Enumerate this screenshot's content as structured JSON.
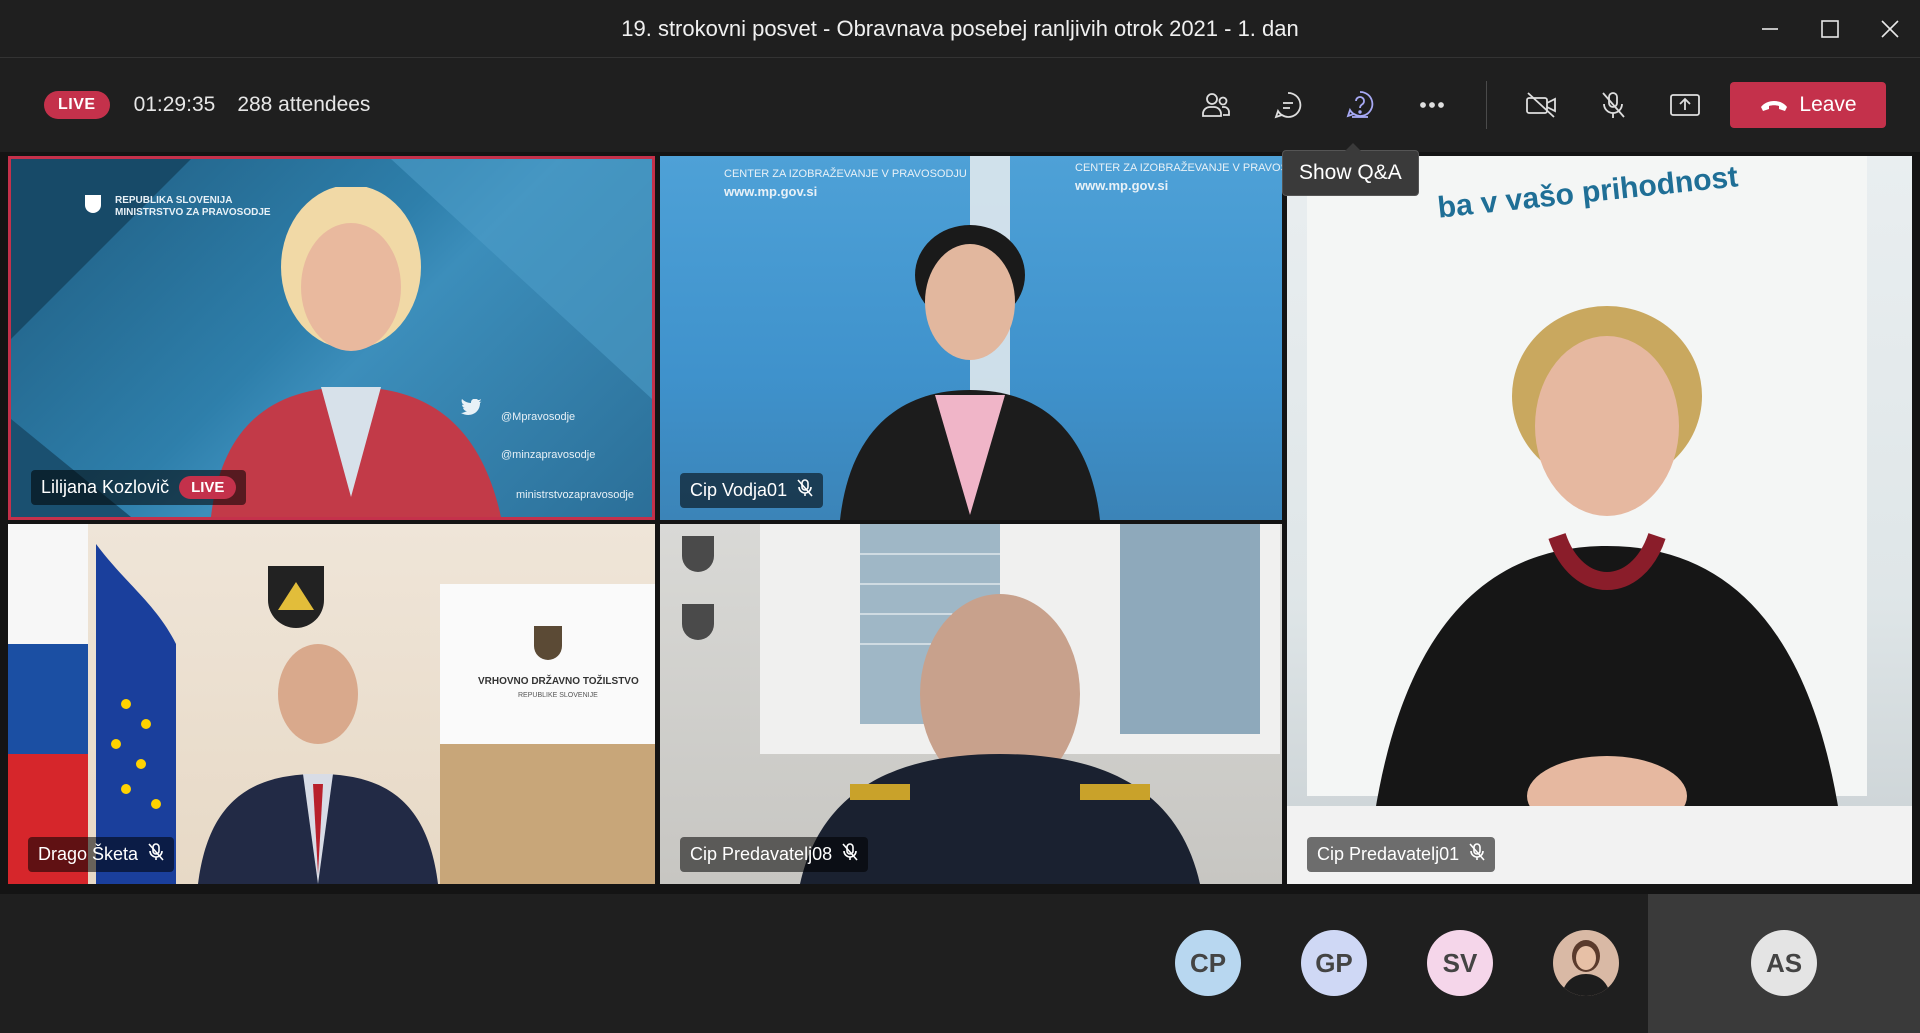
{
  "window": {
    "title": "19. strokovni posvet - Obravnava posebej ranljivih otrok 2021 - 1. dan"
  },
  "toolbar": {
    "live_label": "LIVE",
    "timer": "01:29:35",
    "attendees": "288 attendees",
    "leave_label": "Leave",
    "tooltip": "Show Q&A"
  },
  "tiles": [
    {
      "name": "Lilijana Kozlovič",
      "badge": "LIVE"
    },
    {
      "name": "Cip Vodja01"
    },
    {
      "name": "Cip Predavatelj01"
    },
    {
      "name": "Drago Šketa"
    },
    {
      "name": "Cip Predavatelj08"
    }
  ],
  "tile_texts": {
    "t1_org": "REPUBLIKA SLOVENIJA\nMINISTRSTVO ZA PRAVOSODJE",
    "t1_tw1": "@Mpravosodje",
    "t1_tw2": "@minzapravosodje",
    "t1_tw3": "ministrstvozapravosodje",
    "t2_center": "CENTER ZA IZOBRAŽEVANJE V PRAVOSODJU",
    "t2_web": "www.mp.gov.si",
    "t2_center_r": "CENTER ZA IZOBRAŽEVANJE V PRAVOSODJU",
    "t2_web_r": "www.mp.gov.si",
    "t4_org": "VRHOVNO DRŽAVNO TOŽILSTVO",
    "t4_sub": "REPUBLIKE SLOVENIJE",
    "t3_banner": "ba v vašo prihodnost"
  },
  "participants": [
    {
      "initials": "CP",
      "color": "#b8d7f0"
    },
    {
      "initials": "GP",
      "color": "#cfd8f5"
    },
    {
      "initials": "SV",
      "color": "#f5d6ea"
    },
    {
      "initials": "",
      "color": "#d9b9a5"
    },
    {
      "initials": "AS",
      "color": "#e4e4e4"
    }
  ],
  "colors": {
    "accent_red": "#c4314b",
    "active_icon": "#a7a9f4"
  }
}
